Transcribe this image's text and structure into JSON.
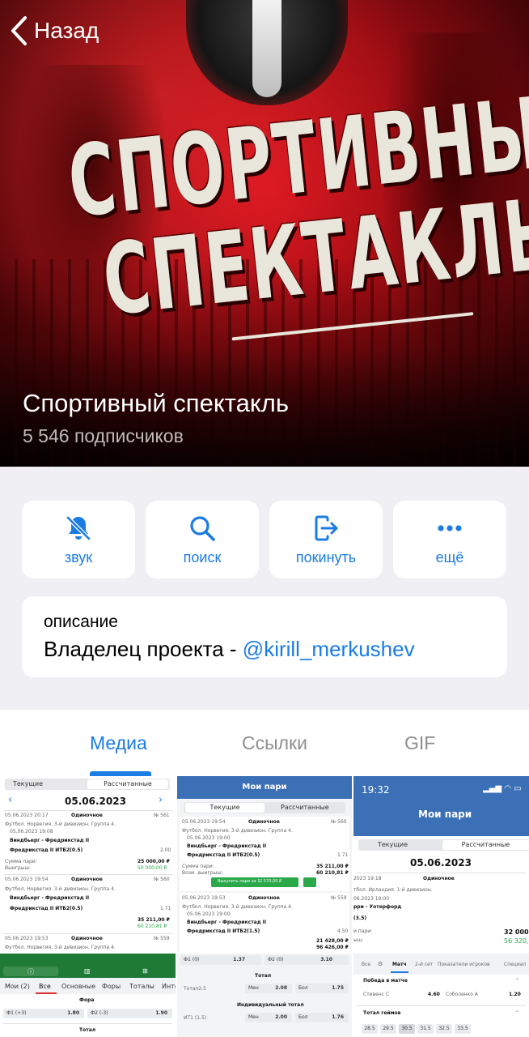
{
  "header": {
    "back_label": "Назад",
    "channel_name": "Спортивный спектакль",
    "subscribers": "5 546 подписчиков",
    "logo_line1": "СПОРТИВНЫЙ",
    "logo_line2": "СПЕКТАКЛЬ"
  },
  "actions": [
    {
      "label": "звук",
      "icon": "bell-muted-icon"
    },
    {
      "label": "поиск",
      "icon": "search-icon"
    },
    {
      "label": "покинуть",
      "icon": "leave-icon"
    },
    {
      "label": "ещё",
      "icon": "more-icon"
    }
  ],
  "description": {
    "heading": "описание",
    "text": "Владелец проекта - ",
    "link": "@kirill_merkushev"
  },
  "tabs": [
    {
      "label": "Медиа",
      "active": true
    },
    {
      "label": "Ссылки",
      "active": false
    },
    {
      "label": "GIF",
      "active": false
    }
  ],
  "colors": {
    "accent": "#1b7ce4",
    "background": "#efeff4",
    "card": "#ffffff"
  },
  "media": {
    "thumb1": {
      "tab_current": "Текущие",
      "tab_settled": "Рассчитанные",
      "date": "05.06.2023",
      "bet1_time": "05.06.2023 20:17",
      "bet1_type": "Одиночное",
      "bet1_no": "№ 561",
      "bet1_league": "Футбол. Норвегия. 3-й дивизион. Группа 4.",
      "bet1_match_date": "05.06.2023 19:08",
      "bet1_match": "Виндбьерг - Фредрикстад II",
      "bet1_pick": "Фредрикстад II ИТБ2(0.5)",
      "bet1_odds": "2.00",
      "bet1_sum_label": "Сумма пари:",
      "bet1_sum": "25 000,00 ₽",
      "bet1_win_label": "Выигрыш:",
      "bet1_win": "50 000,00 ₽",
      "bet2_time": "05.06.2023 19:54",
      "bet2_type": "Одиночное",
      "bet2_no": "№ 560",
      "bet2_league": "Футбол. Норвегия. 3-й дивизион. Группа 4.",
      "bet2_match": "Виндбьерг - Фредрикстад II",
      "bet2_pick": "Фредрикстад II ИТБ2(0.5)",
      "bet2_odds": "1.71",
      "bet2_sum": "35 211,00 ₽",
      "bet2_win": "60 210,81 ₽",
      "bet3_time": "05.06.2023 19:53",
      "bet3_type": "Одиночное",
      "bet3_no": "№ 559",
      "bet3_league": "Футбол. Норвегия. 3-й дивизион. Группа 4."
    },
    "thumb2": {
      "title": "Мои пари",
      "tab_current": "Текущие",
      "tab_settled": "Рассчитанные",
      "b1_time": "05.06.2023 19:54",
      "b1_type": "Одиночное",
      "b1_no": "№ 560",
      "b1_league": "Футбол. Норвегия. 3-й дивизион. Группа 4.",
      "b1_date": "05.06.2023 19:00",
      "b1_match": "Виндбьерг - Фредрикстад II",
      "b1_pick": "Фредрикстад II ИТБ2(0.5)",
      "b1_odds": "1.71",
      "b1_sum_label": "Сумма пари:",
      "b1_sum": "35 211,00 ₽",
      "b1_win_label": "Возм. выигрыш:",
      "b1_win": "60 210,81 ₽",
      "cashout": "Выкупить пари за 32 570,00 ₽",
      "b2_time": "05.06.2023 19:53",
      "b2_type": "Одиночное",
      "b2_no": "№ 559",
      "b2_league": "Футбол. Норвегия. 3-й дивизион. Группа 4.",
      "b2_date": "05.06.2023 19:00",
      "b2_match": "Виндбьерг - Фредрикстад II",
      "b2_pick": "Фредрикстад II ИТБ2(1.5)",
      "b2_odds": "4.50",
      "b2_sum": "21 428,00 ₽",
      "b2_win": "96 426,00 ₽"
    },
    "thumb3": {
      "time": "19:32",
      "title": "Мои пари",
      "tab_current": "Текущие",
      "tab_settled": "Рассчитанные",
      "date": "05.06.2023",
      "bet_time": "2023 19:18",
      "bet_type": "Одиночное",
      "league": "тбол. Ирландия. 1-й дивизион.",
      "match_date": "06.2023 19:00",
      "match": "рри - Уотерфорд",
      "pick": "(3.5)",
      "sum_label": "и пари:",
      "sum": "32 000,",
      "win_label": "ыш:",
      "win": "56 320,"
    },
    "thumb4": {
      "tabs": [
        "Мои (2)",
        "Все",
        "Основные",
        "Форы",
        "Тоталы",
        "Инте"
      ],
      "section1": "Фора",
      "f1": "Ф1 (+3)",
      "f1_odds": "1.80",
      "f2": "Ф2 (-3)",
      "f2_odds": "1.90",
      "section2": "Тотал"
    },
    "thumb5": {
      "row0_a": "Ф1 (0)",
      "row0_a_odds": "1.37",
      "row0_b": "Ф2 (0)",
      "row0_b_odds": "3.10",
      "section1": "Тотал",
      "total_label": "Тотал2.5",
      "under": "Мен",
      "under_odds": "2.08",
      "over": "Бол",
      "over_odds": "1.75",
      "section2": "Индивидуальный тотал",
      "it_label": "ИТ1 (1.5)",
      "it_under": "Мен",
      "it_under_odds": "2.00",
      "it_over": "Бол",
      "it_over_odds": "1.76"
    },
    "thumb6": {
      "tabs": [
        "Все",
        "Матч",
        "2-й сет",
        "Показатели игроков",
        "Специал"
      ],
      "section1": "Победа в матче",
      "p1": "Стивенс С",
      "p1_odds": "4.60",
      "p2": "Соболенко А",
      "p2_odds": "1.20",
      "section2": "Тотал геймов",
      "totals": [
        "28.5",
        "29.5",
        "30.5",
        "31.5",
        "32.5",
        "33.5"
      ]
    }
  }
}
